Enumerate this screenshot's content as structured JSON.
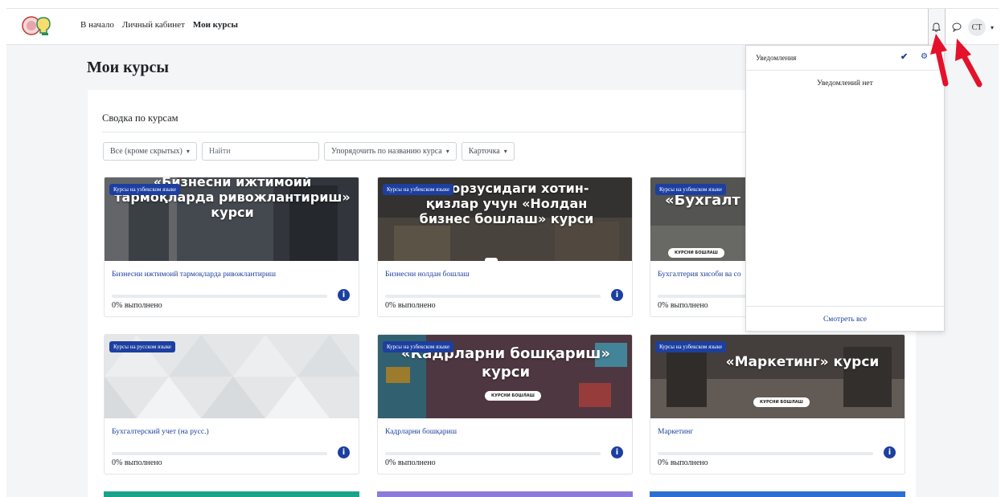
{
  "nav": {
    "home": "В начало",
    "dashboard": "Личный кабинет",
    "my_courses": "Мои курсы"
  },
  "user": {
    "initials": "СТ"
  },
  "page": {
    "title": "Мои курсы",
    "summary_heading": "Сводка по курсам"
  },
  "filters": {
    "grouping": "Все (кроме скрытых)",
    "search_placeholder": "Найти",
    "sort": "Упорядочить по названию курса",
    "view": "Карточка"
  },
  "courses": [
    {
      "badge": "Курсы на узбекском языке",
      "image_text": "«Бизнесни ижтимоий тармоқларда ривожлантириш» курси",
      "name": "Бизнесни ижтимоий тармоқларда ривожлантириш",
      "progress": "0% выполнено",
      "progress_value": 0
    },
    {
      "badge": "Курсы на узбекском языке",
      "image_text": "иш орзусидаги хотин-қизлар учун «Нолдан бизнес бошлаш» курси",
      "name": "Бизнесни нолдан бошлаш",
      "progress": "0% выполнено",
      "progress_value": 0
    },
    {
      "badge": "Курсы на узбекском языке",
      "image_text": "«Бухгалт солиқла",
      "pill": "КУРСНИ БОШЛАШ",
      "name": "Бухгалтерия хисоби ва со",
      "progress": "0% выполнено",
      "progress_value": 0
    },
    {
      "badge": "Курсы на русском языке",
      "name": "Бухгалтерский учет (на русс.)",
      "progress": "0% выполнено",
      "progress_value": 0
    },
    {
      "badge": "Курсы на узбекском языке",
      "image_text": "«Кадрларни бошқариш» курси",
      "pill": "КУРСНИ БОШЛАШ",
      "name": "Кадрларни бошқариш",
      "progress": "0% выполнено",
      "progress_value": 0
    },
    {
      "badge": "Курсы на узбекском языке",
      "image_text": "«Маркетинг» курси",
      "pill": "КУРСНИ БОШЛАШ",
      "name": "Маркетинг",
      "progress": "0% выполнено",
      "progress_value": 0
    }
  ],
  "notifications": {
    "title": "Уведомления",
    "empty": "Уведомлений нет",
    "see_all": "Смотреть все"
  },
  "colors": {
    "accent": "#1c3fa0",
    "annotation_arrow": "#e3122a",
    "page_background": "#f4f5f7"
  },
  "icons": [
    "site-logo",
    "bell-icon",
    "chat-icon",
    "check-icon",
    "gear-icon",
    "info-icon",
    "chevron-down-icon"
  ]
}
